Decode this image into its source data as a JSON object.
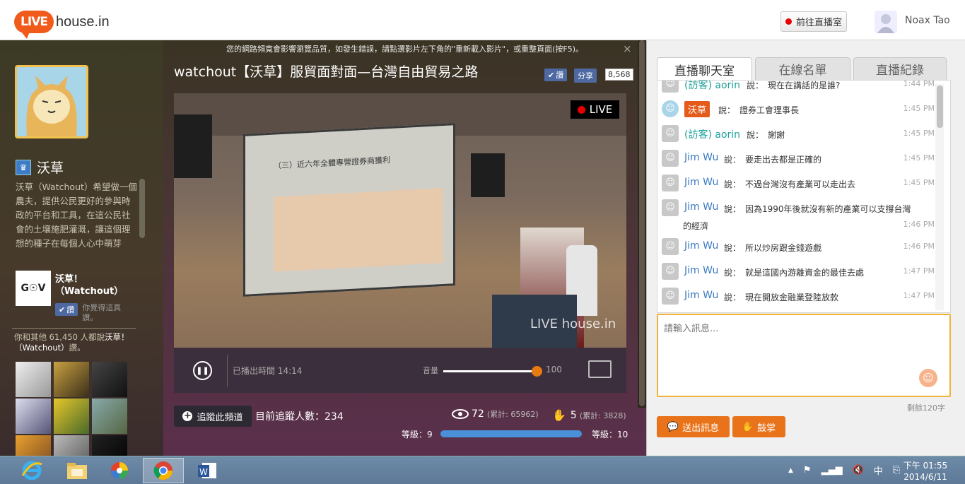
{
  "header": {
    "logo_badge": "LIVE",
    "logo_text": "house.in",
    "goto_live_label": "前往直播室",
    "user_name": "Noax Tao"
  },
  "sidebar": {
    "channel_name": "沃草",
    "channel_description": "沃草（Watchout）希望做一個農夫，提供公民更好的參與時政的平台和工具，在這公民社會的土壤施肥灌溉，讓這個理想的種子在每個人心中萌芽",
    "fb_logo": "G☉V",
    "fb_title": "沃草！（Watchout）",
    "fb_like_label": "讚",
    "fb_like_note": "你覺得這真讚。",
    "fb_count_prefix": "你和其他 61,450 人都說",
    "fb_count_name": "沃草！（Watchout）",
    "fb_count_suffix": "讚。"
  },
  "main": {
    "notice": "您的網路頻寬會影響瀏覽品質，如發生錯誤，請點選影片左下角的\"重新載入影片\"，或重整頁面(按F5)。",
    "notice_close": "×",
    "video_title": "watchout【沃草】服貿面對面—台灣自由貿易之路",
    "like_label": "讚",
    "share_label": "分享",
    "share_count": "8,568",
    "live_badge": "LIVE",
    "screen_slide_title": "（三）近六年全體專營證券商獲利",
    "watermark": "LIVE house.in",
    "elapsed_label": "已播出時間 14:14",
    "volume_label": "音量",
    "volume_value": "100",
    "volume_level": 1.0,
    "follow_label": "追蹤此頻道",
    "tracker_count": "目前追蹤人數：234",
    "viewers": "72",
    "viewers_total": "(累計: 65962)",
    "claps": "5",
    "claps_total": "(累計: 3828)",
    "level_left": "等級：9",
    "level_right": "等級：10",
    "level_progress": 1.0
  },
  "chat": {
    "tabs": [
      "直播聊天室",
      "在線名單",
      "直播紀錄"
    ],
    "messages": [
      {
        "who": "(訪客) aorin",
        "text": "現在在講話的是誰?",
        "time": "1:44 PM",
        "type": "guest"
      },
      {
        "who": "沃草",
        "text": "證券工會理事長",
        "time": "1:45 PM",
        "type": "host"
      },
      {
        "who": "(訪客) aorin",
        "text": "謝謝",
        "time": "1:45 PM",
        "type": "guest"
      },
      {
        "who": "Jim Wu",
        "text": "要走出去都是正確的",
        "time": "1:45 PM",
        "type": "user"
      },
      {
        "who": "Jim Wu",
        "text": "不過台灣沒有產業可以走出去",
        "time": "1:45 PM",
        "type": "user"
      },
      {
        "who": "Jim Wu",
        "text": "因為1990年後就沒有新的產業可以支撐台灣",
        "text2": "的經濟",
        "time": "1:46 PM",
        "type": "user"
      },
      {
        "who": "Jim Wu",
        "text": "所以炒房跟金錢遊戲",
        "time": "1:46 PM",
        "type": "user"
      },
      {
        "who": "Jim Wu",
        "text": "就是這國內游離資金的最佳去處",
        "time": "1:47 PM",
        "type": "user"
      },
      {
        "who": "Jim Wu",
        "text": "現在開放金融業登陸放款",
        "time": "1:47 PM",
        "type": "user"
      }
    ],
    "says": "說：",
    "input_placeholder": "請輸入訊息...",
    "remaining": "剩餘120字",
    "send_label": "送出訊息",
    "clap_label": "鼓掌"
  },
  "taskbar": {
    "apps": [
      "ie-icon",
      "file-explorer-icon",
      "picasa-icon",
      "chrome-icon",
      "word-icon"
    ],
    "tray_ime": "中",
    "clock_time": "下午 01:55",
    "clock_date": "2014/6/11"
  },
  "colors": {
    "accent": "#e8731a",
    "live_red": "#e60000",
    "link_blue": "#3b7bc0",
    "fb_blue": "#4e69a2"
  }
}
